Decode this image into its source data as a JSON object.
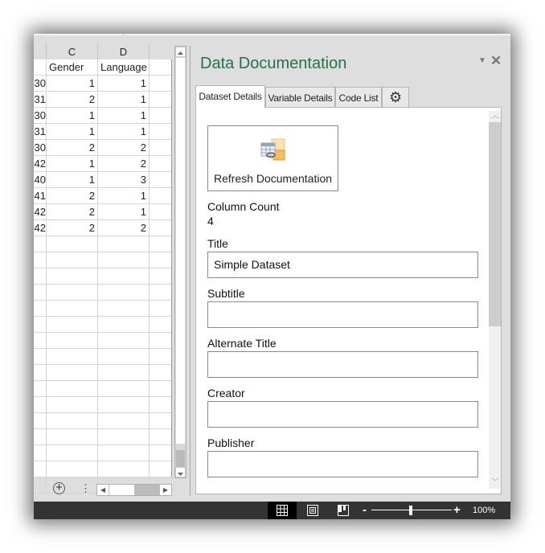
{
  "spreadsheet": {
    "columns": [
      {
        "letter": "C"
      },
      {
        "letter": "D"
      }
    ],
    "header_row": {
      "b_partial": "",
      "c": "Gender",
      "d": "Language"
    },
    "rows": [
      {
        "b": "30",
        "c": "1",
        "d": "1"
      },
      {
        "b": "31",
        "c": "2",
        "d": "1"
      },
      {
        "b": "30",
        "c": "1",
        "d": "1"
      },
      {
        "b": "31",
        "c": "1",
        "d": "1"
      },
      {
        "b": "30",
        "c": "2",
        "d": "2"
      },
      {
        "b": "42",
        "c": "1",
        "d": "2"
      },
      {
        "b": "40",
        "c": "1",
        "d": "3"
      },
      {
        "b": "41",
        "c": "2",
        "d": "1"
      },
      {
        "b": "42",
        "c": "2",
        "d": "1"
      },
      {
        "b": "42",
        "c": "2",
        "d": "2"
      }
    ],
    "add_sheet_icon": "plus-circle-icon",
    "more_icon": "vertical-dots-icon"
  },
  "task_pane": {
    "title": "Data Documentation",
    "menu_icon": "dropdown-arrow-icon",
    "close_icon": "close-icon",
    "tabs": [
      {
        "label": "Dataset Details",
        "active": true
      },
      {
        "label": "Variable Details",
        "active": false
      },
      {
        "label": "Code List",
        "active": false
      },
      {
        "label": "",
        "icon": "gear-icon",
        "active": false
      }
    ],
    "refresh_button": {
      "label": "Refresh Documentation",
      "icon": "table-link-icon"
    },
    "column_count": {
      "label": "Column Count",
      "value": "4"
    },
    "fields": [
      {
        "label": "Title",
        "value": "Simple Dataset"
      },
      {
        "label": "Subtitle",
        "value": ""
      },
      {
        "label": "Alternate Title",
        "value": ""
      },
      {
        "label": "Creator",
        "value": ""
      },
      {
        "label": "Publisher",
        "value": ""
      }
    ]
  },
  "status_bar": {
    "views": [
      {
        "name": "normal-view",
        "active": true
      },
      {
        "name": "page-layout-view",
        "active": false
      },
      {
        "name": "page-break-preview",
        "active": false
      }
    ],
    "zoom_minus": "-",
    "zoom_plus": "+",
    "zoom_level": "100%",
    "zoom_percent": 100
  }
}
